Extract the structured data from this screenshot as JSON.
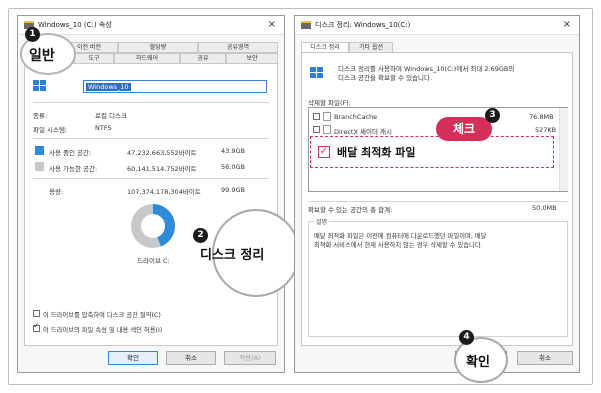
{
  "left_window": {
    "title": "Windows_10 (C:) 속성",
    "close_glyph": "×",
    "tabs_row1": [
      "이전 버전",
      "할당량",
      "공유영역"
    ],
    "tabs_row2": [
      "일반",
      "도구",
      "하드웨어",
      "공유",
      "보안"
    ],
    "drive_name": "Windows_10",
    "type_label": "종류:",
    "type_value": "로컬 디스크",
    "fs_label": "파일 시스템:",
    "fs_value": "NTFS",
    "used_label": "사용 중인 공간:",
    "used_bytes": "47,232,663,552바이트",
    "used_gb": "43.9GB",
    "free_label": "사용 가능한 공간:",
    "free_bytes": "60,141,514,752바이트",
    "free_gb": "56.0GB",
    "capacity_label": "용량:",
    "capacity_bytes": "107,374,178,304바이트",
    "capacity_gb": "99.9GB",
    "drive_caption": "드라이브 C:",
    "used_fraction": 0.44,
    "compress_label": "이 드라이브를 압축하여 디스크 공간 절약(C)",
    "index_label": "이 드라이브의 파일 속성 및 내용 색인 허용(I)",
    "btn_ok": "확인",
    "btn_cancel": "취소",
    "btn_apply": "적용(A)",
    "colors": {
      "used": "#2f8ad8",
      "free": "#c8c8c8"
    }
  },
  "right_window": {
    "title": "디스크 정리: Windows_10(C:)",
    "close_glyph": "×",
    "tabs": [
      "디스크 정리",
      "기타 옵션"
    ],
    "intro_line1": "디스크 정리를 사용하여 Windows_10(C:)에서 최대 2.69GB의",
    "intro_line2": "디스크 공간을 확보할 수 있습니다.",
    "files_label": "삭제할 파일(F):",
    "files": [
      {
        "name": "BranchCache",
        "size": "76.8MB"
      },
      {
        "name": "DirectX 셰이더 캐시",
        "size": "527KB"
      }
    ],
    "highlight_item": "배달 최적화 파일",
    "total_label": "확보할 수 있는 공간의 총 합계:",
    "total_value": "50.0MB",
    "desc_label": "설명",
    "desc_line1": "배달 최적화 파일은 이전에 컴퓨터에 다운로드했던 파일이며, 배달",
    "desc_line2": "최적화 서비스에서 현재 사용하지 않는 경우 삭제할 수 있습니다.",
    "btn_ok": "확인",
    "btn_cancel": "취소"
  },
  "annotations": {
    "step1_num": "1",
    "step1_text": "일반",
    "step2_num": "2",
    "step2_text": "디스크 정리",
    "step3_num": "3",
    "step3_text": "체크",
    "step4_num": "4",
    "step4_text": "확인",
    "check_glyph": "✓",
    "accent": "#d32f5a"
  }
}
